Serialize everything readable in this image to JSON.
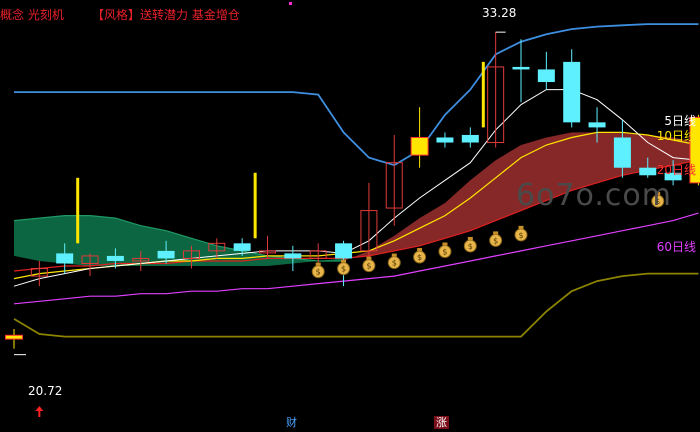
{
  "header": {
    "concept": "概念 光刻机",
    "style": "【风格】送转潜力 基金增仓"
  },
  "legend": {
    "ma5": "5日线",
    "ma10": "10日线",
    "ma20": "20日线",
    "ma60": "60日线"
  },
  "annotations": {
    "high": "33.28",
    "low": "20.72",
    "tag_cai": "财",
    "tag_zhang": "涨",
    "watermark": "6o7o.com"
  },
  "colors": {
    "up": "#e03a3a",
    "down": "#5ff0ff",
    "ma5": "#ffffff",
    "ma10": "#ffe600",
    "ma20": "#e02020",
    "ma60": "#e040ff",
    "band_upper": "#3f8fe0",
    "band_lower": "#8c8400",
    "cloud_green": "#0c6b45",
    "cloud_red": "#8e2a2a"
  },
  "chart_data": {
    "type": "candlestick",
    "price_range": [
      19.0,
      34.0
    ],
    "candles": [
      {
        "o": 21.1,
        "h": 21.5,
        "l": 20.72,
        "c": 21.25
      },
      {
        "o": 23.6,
        "h": 24.2,
        "l": 23.2,
        "c": 23.9
      },
      {
        "o": 24.5,
        "h": 24.9,
        "l": 23.7,
        "c": 24.1
      },
      {
        "o": 24.1,
        "h": 24.5,
        "l": 23.6,
        "c": 24.4
      },
      {
        "o": 24.4,
        "h": 24.7,
        "l": 23.9,
        "c": 24.2
      },
      {
        "o": 24.2,
        "h": 24.6,
        "l": 23.8,
        "c": 24.3
      },
      {
        "o": 24.6,
        "h": 25.0,
        "l": 24.1,
        "c": 24.3
      },
      {
        "o": 24.3,
        "h": 24.8,
        "l": 23.9,
        "c": 24.6
      },
      {
        "o": 24.6,
        "h": 25.1,
        "l": 24.3,
        "c": 24.9
      },
      {
        "o": 24.9,
        "h": 25.1,
        "l": 24.4,
        "c": 24.6
      },
      {
        "o": 24.6,
        "h": 25.2,
        "l": 24.3,
        "c": 24.6
      },
      {
        "o": 24.5,
        "h": 24.8,
        "l": 23.8,
        "c": 24.3
      },
      {
        "o": 24.3,
        "h": 24.9,
        "l": 24.0,
        "c": 24.6
      },
      {
        "o": 24.9,
        "h": 25.0,
        "l": 23.2,
        "c": 24.3
      },
      {
        "o": 24.6,
        "h": 27.3,
        "l": 24.2,
        "c": 26.2
      },
      {
        "o": 26.3,
        "h": 29.2,
        "l": 25.6,
        "c": 28.1
      },
      {
        "o": 28.4,
        "h": 30.3,
        "l": 27.9,
        "c": 29.1
      },
      {
        "o": 29.1,
        "h": 29.3,
        "l": 28.7,
        "c": 28.9
      },
      {
        "o": 29.2,
        "h": 29.5,
        "l": 28.7,
        "c": 28.9
      },
      {
        "o": 28.9,
        "h": 33.28,
        "l": 28.7,
        "c": 31.9
      },
      {
        "o": 31.9,
        "h": 33.0,
        "l": 30.5,
        "c": 31.8
      },
      {
        "o": 31.8,
        "h": 32.5,
        "l": 31.0,
        "c": 31.3
      },
      {
        "o": 32.1,
        "h": 32.6,
        "l": 29.5,
        "c": 29.7
      },
      {
        "o": 29.7,
        "h": 30.3,
        "l": 28.9,
        "c": 29.5
      },
      {
        "o": 29.1,
        "h": 29.8,
        "l": 27.5,
        "c": 27.9
      },
      {
        "o": 27.9,
        "h": 28.3,
        "l": 27.5,
        "c": 27.6
      },
      {
        "o": 27.7,
        "h": 28.2,
        "l": 27.2,
        "c": 27.4
      },
      {
        "o": 27.3,
        "h": 30.0,
        "l": 27.2,
        "c": 29.9
      }
    ],
    "highlight_bars": [
      0,
      16,
      27
    ],
    "spikes": [
      2,
      9,
      18
    ],
    "ma5": [
      23.2,
      23.5,
      23.7,
      23.9,
      24.0,
      24.1,
      24.2,
      24.3,
      24.4,
      24.5,
      24.6,
      24.6,
      24.6,
      24.5,
      25.0,
      25.9,
      26.7,
      27.4,
      28.1,
      29.4,
      30.4,
      31.0,
      31.0,
      30.6,
      29.8,
      28.9,
      28.3,
      28.2
    ],
    "ma10": [
      23.5,
      23.7,
      23.8,
      23.9,
      24.0,
      24.1,
      24.2,
      24.2,
      24.3,
      24.3,
      24.4,
      24.4,
      24.4,
      24.5,
      24.6,
      25.0,
      25.5,
      26.0,
      26.7,
      27.5,
      28.3,
      28.8,
      29.1,
      29.3,
      29.3,
      29.2,
      29.0,
      28.8
    ],
    "ma20": [
      23.8,
      23.9,
      24.0,
      24.0,
      24.1,
      24.1,
      24.1,
      24.2,
      24.2,
      24.2,
      24.3,
      24.3,
      24.3,
      24.3,
      24.4,
      24.6,
      24.8,
      25.1,
      25.4,
      25.8,
      26.2,
      26.6,
      27.0,
      27.3,
      27.6,
      27.8,
      28.0,
      28.2
    ],
    "ma60": [
      22.5,
      22.6,
      22.7,
      22.8,
      22.8,
      22.9,
      22.9,
      23.0,
      23.0,
      23.1,
      23.1,
      23.2,
      23.3,
      23.4,
      23.5,
      23.6,
      23.8,
      24.0,
      24.2,
      24.4,
      24.6,
      24.8,
      25.0,
      25.2,
      25.4,
      25.6,
      25.8,
      26.1
    ],
    "cloud_top": [
      25.8,
      25.9,
      26.0,
      26.0,
      25.9,
      25.6,
      25.4,
      25.1,
      24.8,
      24.6,
      24.4,
      24.3,
      24.2,
      24.2,
      24.6,
      25.2,
      25.9,
      26.5,
      27.4,
      28.2,
      28.8,
      29.1,
      29.3,
      29.3,
      29.3,
      29.2,
      29.1,
      28.9
    ],
    "cloud_bottom": [
      24.4,
      24.2,
      24.1,
      24.0,
      24.0,
      24.0,
      24.0,
      24.0,
      24.0,
      24.0,
      24.0,
      24.1,
      24.2,
      24.3,
      24.4,
      24.6,
      24.8,
      25.1,
      25.4,
      25.8,
      26.2,
      26.6,
      27.0,
      27.3,
      27.6,
      27.8,
      28.0,
      28.2
    ],
    "band_upper": [
      [
        0,
        30.9
      ],
      [
        11,
        30.9
      ],
      [
        12,
        30.8
      ],
      [
        13,
        29.3
      ],
      [
        14,
        28.3
      ],
      [
        15,
        28.0
      ],
      [
        16,
        28.6
      ],
      [
        17,
        30.0
      ],
      [
        18,
        31.0
      ],
      [
        19,
        32.4
      ],
      [
        20,
        32.9
      ],
      [
        21,
        33.2
      ],
      [
        22,
        33.4
      ],
      [
        23,
        33.5
      ],
      [
        24,
        33.55
      ],
      [
        25,
        33.6
      ],
      [
        26,
        33.6
      ],
      [
        27,
        33.6
      ]
    ],
    "band_lower": [
      [
        0,
        21.9
      ],
      [
        1,
        21.3
      ],
      [
        2,
        21.2
      ],
      [
        20,
        21.2
      ],
      [
        21,
        22.2
      ],
      [
        22,
        23.0
      ],
      [
        23,
        23.4
      ],
      [
        24,
        23.6
      ],
      [
        25,
        23.7
      ],
      [
        27,
        23.7
      ]
    ],
    "money_bags": [
      12,
      13,
      14,
      15,
      16,
      17,
      18,
      19,
      20,
      25
    ]
  }
}
